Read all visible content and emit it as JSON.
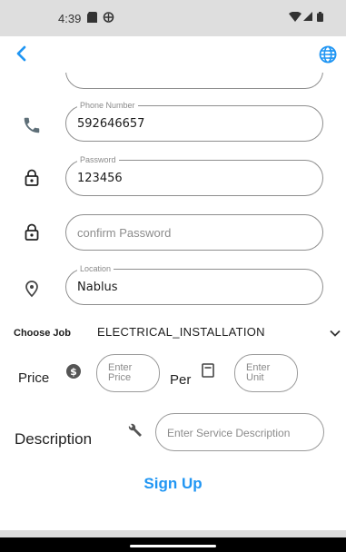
{
  "status_bar": {
    "time": "4:39"
  },
  "form": {
    "phone": {
      "label": "Phone Number",
      "value": "592646657"
    },
    "password": {
      "label": "Password",
      "value": "123456"
    },
    "confirm_password": {
      "placeholder": "confirm Password"
    },
    "location": {
      "label": "Location",
      "value": "Nablus"
    },
    "job": {
      "label": "Choose Job",
      "value": "ELECTRICAL_INSTALLATION"
    },
    "price": {
      "label": "Price",
      "placeholder": "Enter Price"
    },
    "per": {
      "label": "Per",
      "placeholder": "Enter Unit"
    },
    "description": {
      "label": "Description",
      "placeholder": "Enter Service Description"
    },
    "submit_label": "Sign Up"
  },
  "colors": {
    "accent": "#2196f3",
    "status_bar": "#dedede",
    "nav_bar": "#000000"
  },
  "icons": [
    "back-arrow-icon",
    "globe-icon",
    "phone-icon",
    "lock-icon",
    "location-pin-icon",
    "chevron-down-icon",
    "dollar-icon",
    "calendar-icon",
    "wrench-icon"
  ]
}
